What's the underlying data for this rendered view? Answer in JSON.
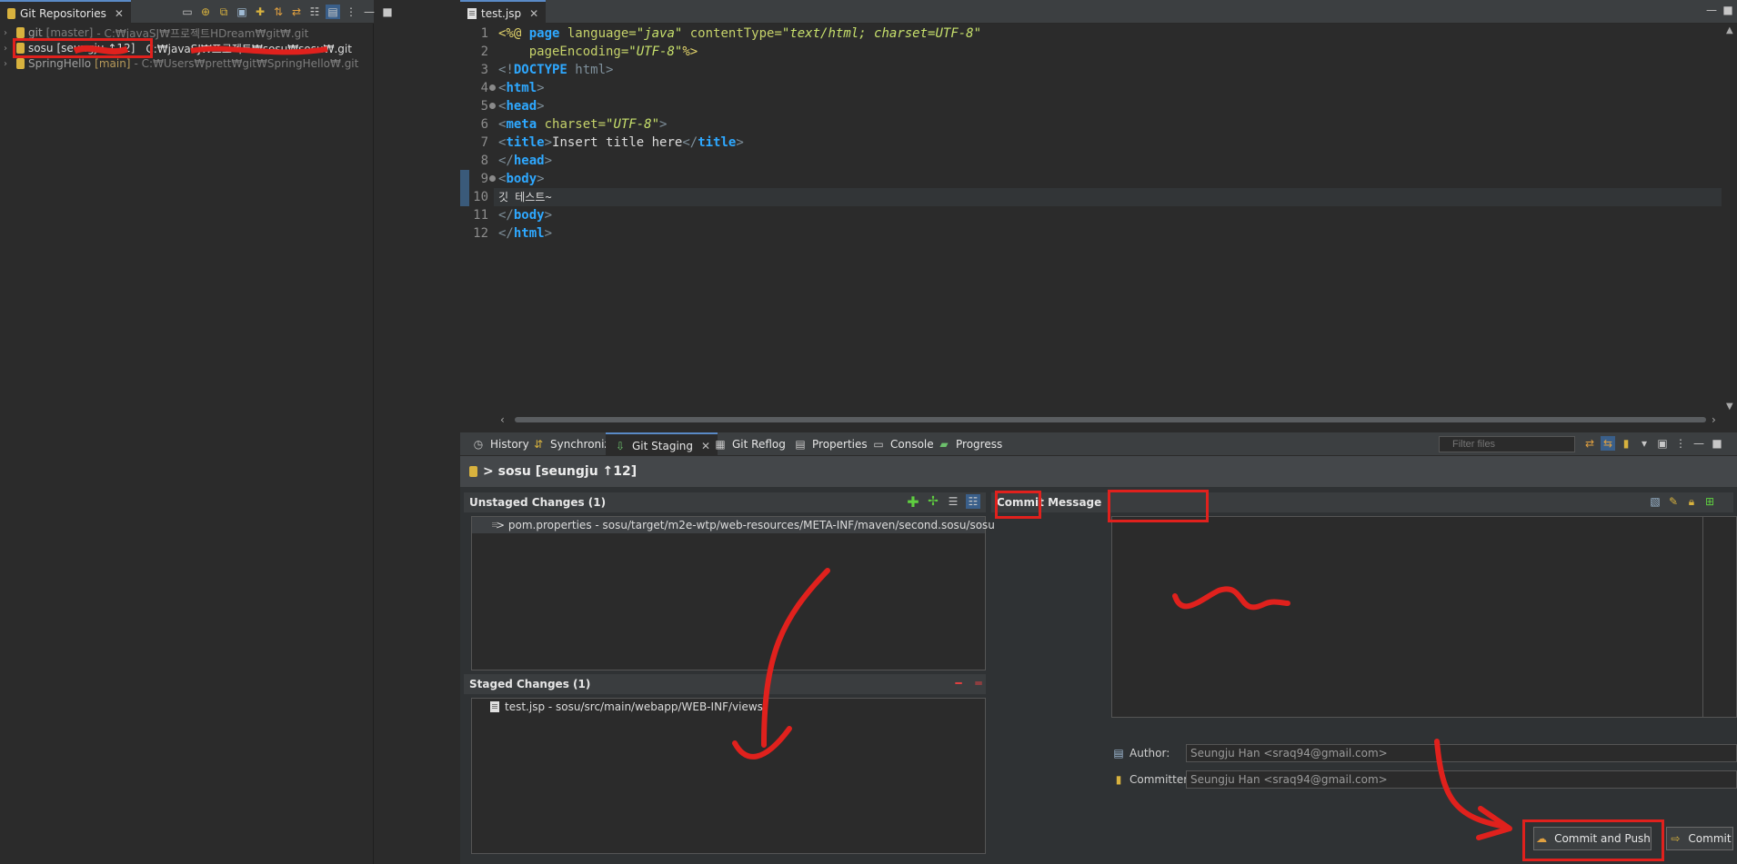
{
  "left_panel": {
    "tab_title": "Git Repositories",
    "repos": [
      {
        "name": "git",
        "branch": "[master]",
        "path": "- C:₩javaSJ₩프로젝트HDream₩git₩.git"
      },
      {
        "name": "sosu",
        "branch": "[seungju ↑12]",
        "path": "C:₩javaSJ₩프로젝트₩sosu₩sosu₩.git"
      },
      {
        "name": "SpringHello",
        "branch": "[main]",
        "path": "- C:₩Users₩prett₩git₩SpringHello₩.git"
      }
    ]
  },
  "editor": {
    "tab_title": "test.jsp",
    "lines": [
      {
        "n": "1"
      },
      {
        "n": "2"
      },
      {
        "n": "3"
      },
      {
        "n": "4"
      },
      {
        "n": "5"
      },
      {
        "n": "6"
      },
      {
        "n": "7"
      },
      {
        "n": "8"
      },
      {
        "n": "9"
      },
      {
        "n": "10"
      },
      {
        "n": "11"
      },
      {
        "n": "12"
      }
    ],
    "code": {
      "l1_a": "<%@ ",
      "l1_kw": "page",
      "l1_attr1": " language=",
      "l1_val1": "\"java\"",
      "l1_attr2": " contentType=",
      "l1_val2": "\"text/html; charset=UTF-8\"",
      "l2_attr": "    pageEncoding=",
      "l2_val": "\"UTF-8\"",
      "l2_end": "%>",
      "l3_a": "<!",
      "l3_kw": "DOCTYPE",
      "l3_b": " html>",
      "html": "html",
      "head": "head",
      "meta": "meta",
      "meta_attr": " charset=",
      "meta_val": "\"UTF-8\"",
      "title": "title",
      "title_text": "Insert title here",
      "body": "body",
      "body_text": "깃 테스트~"
    }
  },
  "bottom_tabs": [
    "History",
    "Synchronize",
    "Git Staging",
    "Git Reflog",
    "Properties",
    "Console",
    "Progress"
  ],
  "filter_placeholder": "Filter files",
  "staging": {
    "repo_header": "> sosu [seungju ↑12]",
    "unstaged_title": "Unstaged Changes (1)",
    "unstaged_items": [
      "> pom.properties - sosu/target/m2e-wtp/web-resources/META-INF/maven/second.sosu/sosu"
    ],
    "staged_title": "Staged Changes (1)",
    "staged_items": [
      "test.jsp - sosu/src/main/webapp/WEB-INF/views"
    ],
    "commit_message_title": "Commit Message",
    "author_label": "Author:",
    "author_value": "Seungju Han <sraq94@gmail.com>",
    "committer_label": "Committer:",
    "committer_value": "Seungju Han <sraq94@gmail.com>",
    "commit_push_label": "Commit and Push",
    "commit_label": "Commit"
  }
}
